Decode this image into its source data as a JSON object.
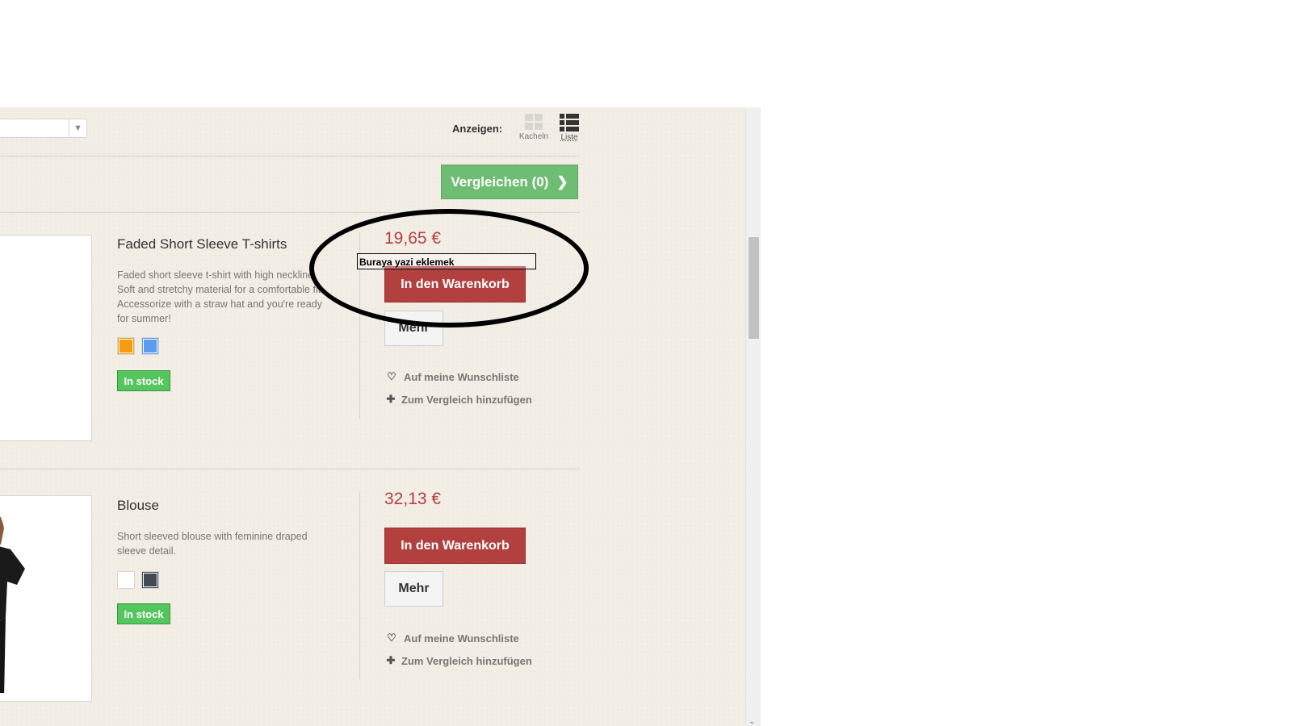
{
  "toolbar": {
    "view_label": "Anzeigen:",
    "view_grid_label": "Kacheln",
    "view_list_label": "Liste",
    "compare_label": "Vergleichen (0)"
  },
  "products": [
    {
      "name": "Faded Short Sleeve T-shirts",
      "description_lines": [
        "Faded short sleeve t-shirt with high neckline.",
        "Soft and stretchy material for a comfortable fit.",
        "Accessorize with a straw hat and you're ready",
        "for summer!"
      ],
      "swatches": [
        "#f39c11",
        "#5d9cec"
      ],
      "stock": "In stock",
      "price": "19,65 €",
      "cart_label": "In den Warenkorb",
      "more_label": "Mehr",
      "wishlist_label": "Auf meine Wunschliste",
      "compare_add_label": "Zum Vergleich hinzufügen"
    },
    {
      "name": "Blouse",
      "description_lines": [
        "Short sleeved blouse with feminine draped",
        "sleeve detail."
      ],
      "swatches": [
        "#ffffff",
        "#434a54"
      ],
      "stock": "In stock",
      "price": "32,13 €",
      "cart_label": "In den Warenkorb",
      "more_label": "Mehr",
      "wishlist_label": "Auf meine Wunschliste",
      "compare_add_label": "Zum Vergleich hinzufügen"
    }
  ],
  "annotation": {
    "text": "Buraya yazi eklemek"
  },
  "colors": {
    "page_bg": "#f2ede5",
    "price": "#b53f45",
    "cart_button": "#b2403f",
    "compare_button": "#6fbd73",
    "stock_badge": "#55c65e"
  }
}
